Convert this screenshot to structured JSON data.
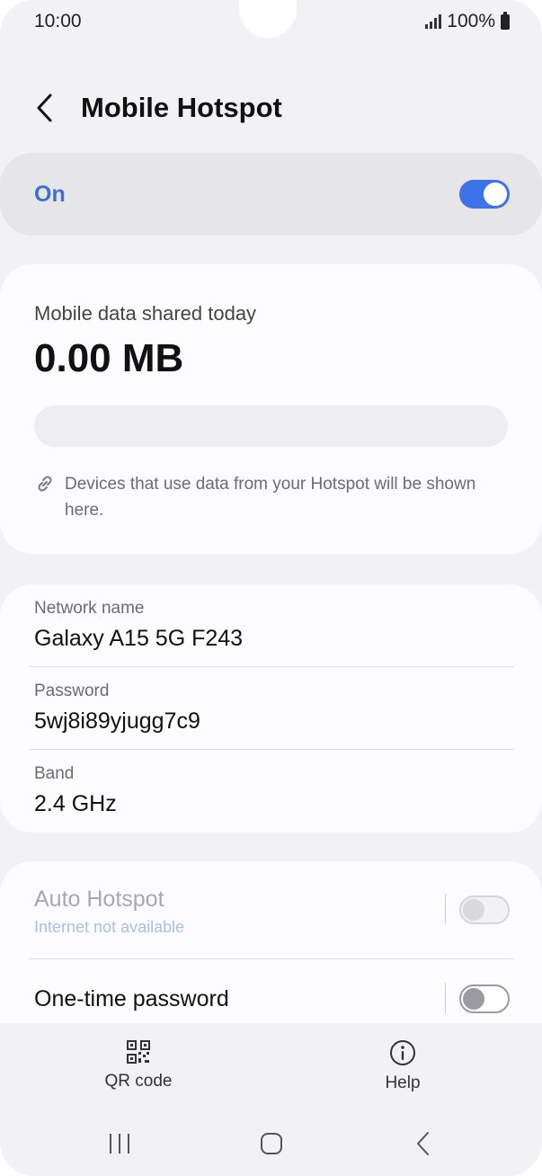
{
  "status_bar": {
    "time": "10:00",
    "battery": "100%"
  },
  "header": {
    "title": "Mobile Hotspot"
  },
  "master_toggle": {
    "label": "On",
    "state": "on",
    "accent": "#3e73e8"
  },
  "usage": {
    "label": "Mobile data shared today",
    "value": "0.00 MB",
    "bar_fraction": 0,
    "note": "Devices that use data from your Hotspot will be shown here."
  },
  "network": {
    "items": [
      {
        "label": "Network name",
        "value": "Galaxy A15 5G F243"
      },
      {
        "label": "Password",
        "value": "5wj8i89yjugg7c9"
      },
      {
        "label": "Band",
        "value": "2.4 GHz"
      }
    ]
  },
  "toggles": {
    "auto_hotspot": {
      "title": "Auto Hotspot",
      "subtitle": "Internet not available",
      "state": "off",
      "enabled": false
    },
    "one_time_password": {
      "title": "One-time password",
      "state": "off",
      "enabled": true
    }
  },
  "actions": {
    "qr_label": "QR code",
    "help_label": "Help"
  },
  "icons": {
    "back": "chevron-left-icon",
    "link": "link-icon",
    "qr": "qr-code-icon",
    "help": "info-icon",
    "recents": "recents-icon",
    "home": "home-icon",
    "nav_back": "nav-back-icon"
  }
}
